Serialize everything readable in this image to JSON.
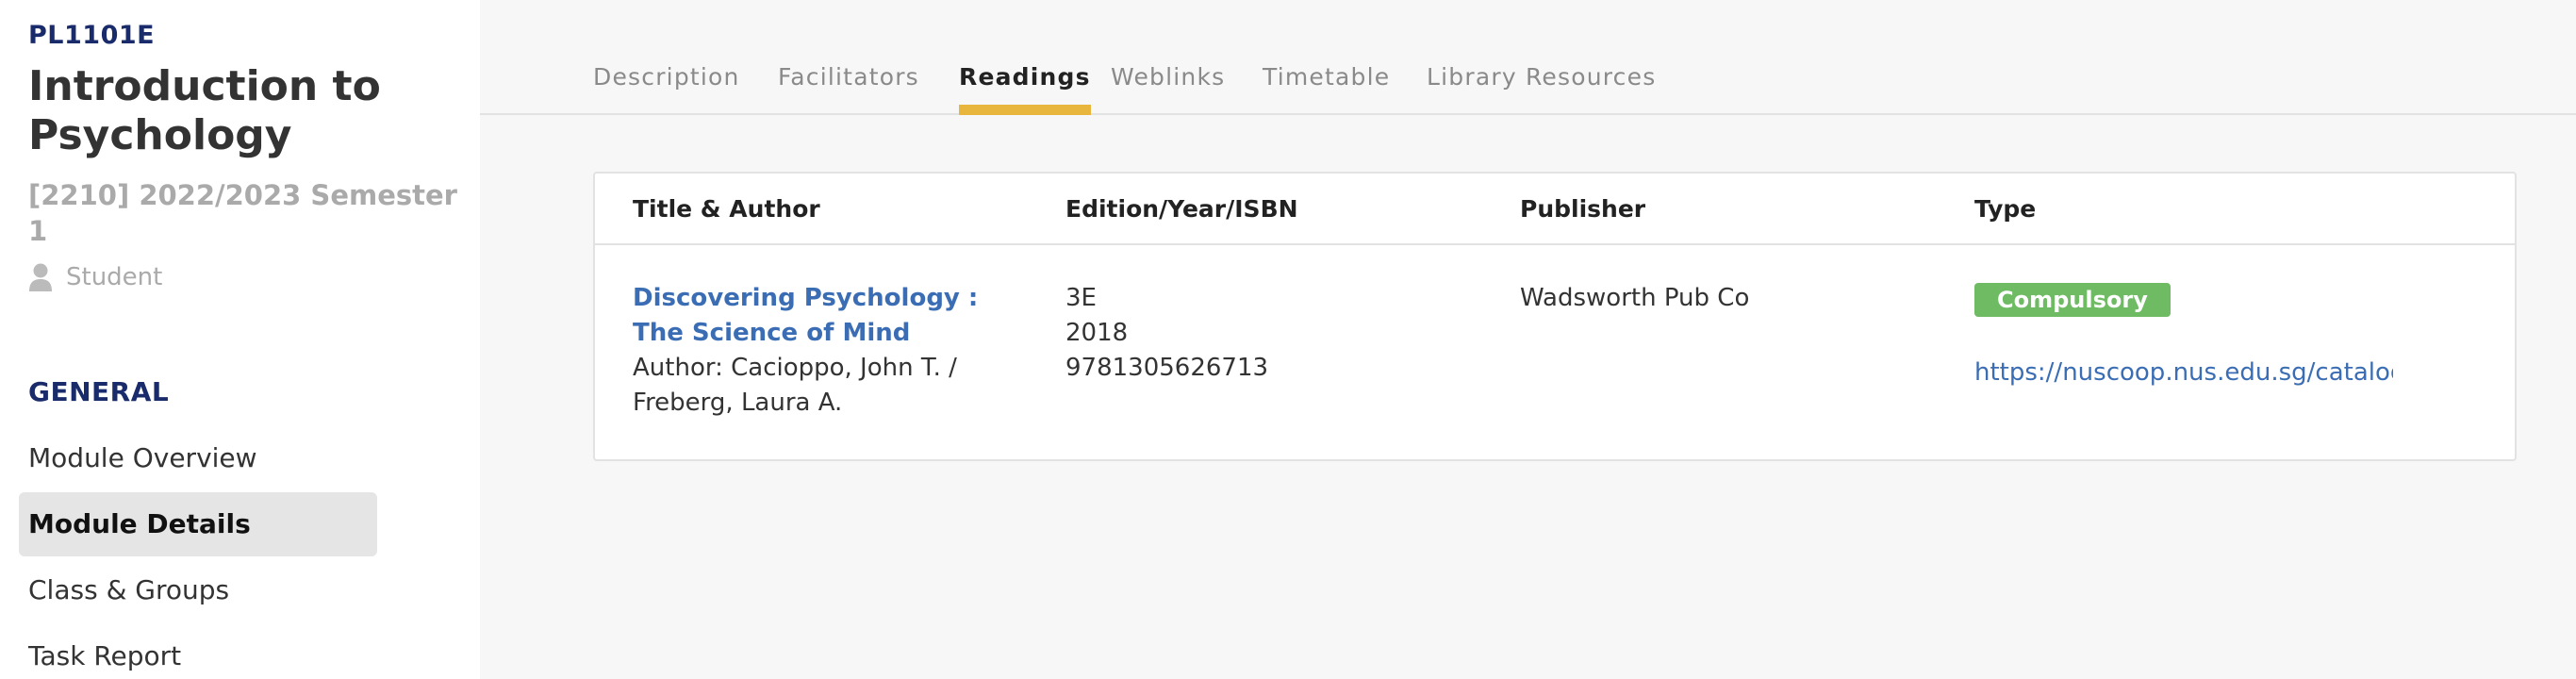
{
  "sidebar": {
    "module_code": "PL1101E",
    "module_title": "Introduction to Psychology",
    "term": "[2210] 2022/2023 Semester 1",
    "role": "Student",
    "section_heading": "GENERAL",
    "items": [
      {
        "label": "Module Overview",
        "active": false
      },
      {
        "label": "Module Details",
        "active": true
      },
      {
        "label": "Class & Groups",
        "active": false
      },
      {
        "label": "Task Report",
        "active": false
      }
    ]
  },
  "tabs": [
    {
      "label": "Description",
      "active": false
    },
    {
      "label": "Facilitators",
      "active": false
    },
    {
      "label": "Readings",
      "active": true
    },
    {
      "label": "Weblinks",
      "active": false
    },
    {
      "label": "Timetable",
      "active": false
    },
    {
      "label": "Library Resources",
      "active": false
    }
  ],
  "readings": {
    "headers": {
      "title_author": "Title & Author",
      "edition": "Edition/Year/ISBN",
      "publisher": "Publisher",
      "type": "Type"
    },
    "rows": [
      {
        "title": "Discovering Psychology : The Science of Mind",
        "author": "Author: Cacioppo, John T. / Freberg, Laura A.",
        "edition": "3E",
        "year": "2018",
        "isbn": "9781305626713",
        "publisher": "Wadsworth Pub Co",
        "type": "Compulsory",
        "url": "https://nuscoop.nus.edu.sg/catalogsearch"
      }
    ]
  },
  "colors": {
    "accent_underline": "#e8b63c",
    "link": "#3b6db4",
    "badge_green": "#6fbb63",
    "navy": "#1a2b6b"
  }
}
